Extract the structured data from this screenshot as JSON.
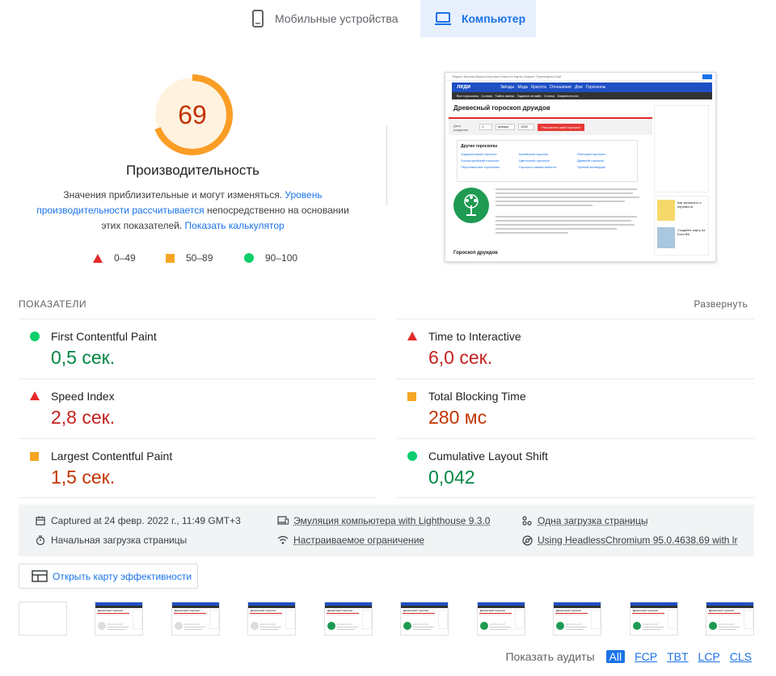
{
  "tabs": {
    "mobile_label": "Мобильные устройства",
    "desktop_label": "Компьютер",
    "active": "desktop"
  },
  "score": {
    "value": "69",
    "fraction": 0.69,
    "color": "#fa9d25",
    "title": "Производительность",
    "desc_part1": "Значения приблизительные и могут изменяться. ",
    "desc_link1": "Уровень производительности рассчитывается",
    "desc_part2": " непосредственно на основании этих показателей. ",
    "desc_link2": "Показать калькулятор"
  },
  "legend": [
    {
      "shape": "triangle",
      "label": "0–49",
      "color": "#e52929"
    },
    {
      "shape": "square",
      "label": "50–89",
      "color": "#f5a623"
    },
    {
      "shape": "circle",
      "label": "90–100",
      "color": "#0cce6b"
    }
  ],
  "screenshot": {
    "nav_items": "Яндекс  Москва  Видео  Картинки  Новости  Карты  Маркет  Переводчик  Ещё",
    "site_logo": "леди",
    "site_nav": [
      "Звёзды",
      "Мода",
      "Красота",
      "Отношения",
      "Дом",
      "Гороскопы"
    ],
    "sub_nav": [
      "Все гороскопы",
      "Сонник",
      "Тайна имени",
      "Гадание онлайн",
      "Статьи",
      "Знаменитости"
    ],
    "heading": "Древесный гороскоп друидов",
    "form_label": "Дата рождения",
    "form_day": "1",
    "form_month": "января",
    "form_year": "1990",
    "form_button": "Рассчитать свой гороскоп",
    "other_title": "Другие гороскопы",
    "other_links": [
      "Зодиакальный гороскоп",
      "Китайский гороскоп",
      "Японский гороскоп",
      "Зороастрийский гороскоп",
      "Цветочный гороскоп",
      "Древний гороскоп",
      "Персональные гороскопы",
      "Гороскоп совместимости",
      "Лунный календарь"
    ],
    "footer_heading": "Гороскоп друидов",
    "side_ad1": "Как заплатить и перевести",
    "side_ad2": "Создайте карту на Бота ВБ"
  },
  "metrics_header": {
    "title": "ПОКАЗАТЕЛИ",
    "expand": "Развернуть"
  },
  "metrics": [
    {
      "name": "First Contentful Paint",
      "value": "0,5 сек.",
      "rating": "good"
    },
    {
      "name": "Time to Interactive",
      "value": "6,0 сек.",
      "rating": "bad"
    },
    {
      "name": "Speed Index",
      "value": "2,8 сек.",
      "rating": "bad"
    },
    {
      "name": "Total Blocking Time",
      "value": "280 мс",
      "rating": "avg"
    },
    {
      "name": "Largest Contentful Paint",
      "value": "1,5 сек.",
      "rating": "avg"
    },
    {
      "name": "Cumulative Layout Shift",
      "value": "0,042",
      "rating": "good"
    }
  ],
  "info": {
    "captured": "Captured at 24 февр. 2022 г., 11:49 GMT+3",
    "emulation": "Эмуляция компьютера with Lighthouse 9.3.0",
    "single_load": "Одна загрузка страницы",
    "initial_load": "Начальная загрузка страницы",
    "throttling": "Настраиваемое ограничение",
    "browser": "Using HeadlessChromium 95.0.4638.69 with lr"
  },
  "treemap": {
    "label": "Открыть карту эффективности"
  },
  "filmstrip": {
    "frame_texts": [
      "Древесный гороскоп",
      "ДРЕВЕСНЫЙ"
    ]
  },
  "audits": {
    "label": "Показать аудиты",
    "filters": [
      "All",
      "FCP",
      "TBT",
      "LCP",
      "CLS"
    ],
    "active": "All"
  }
}
